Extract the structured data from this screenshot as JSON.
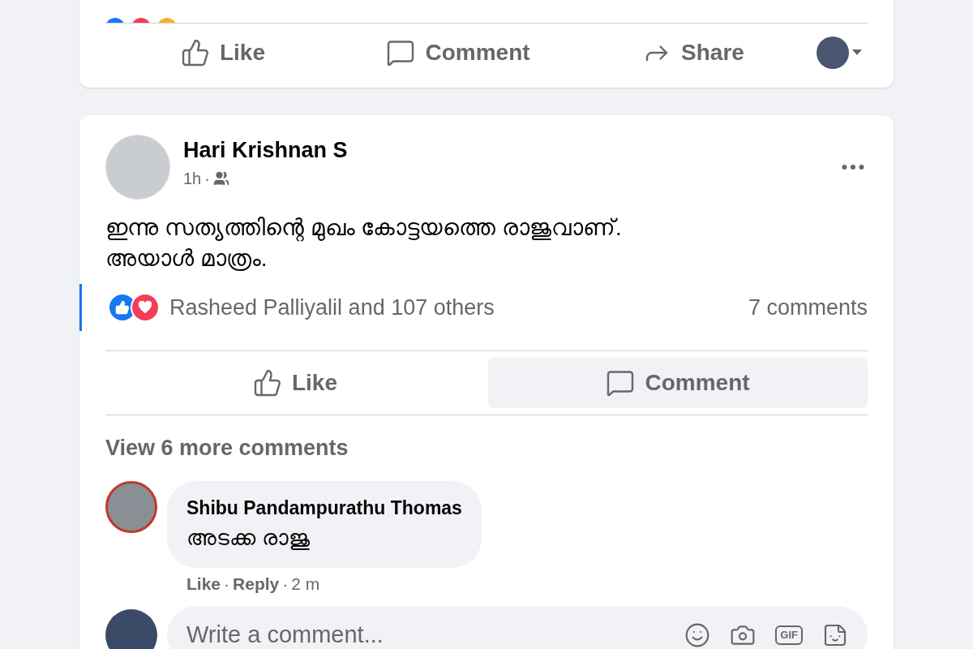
{
  "previous_post": {
    "actions": [
      {
        "kind": "like",
        "label": "Like"
      },
      {
        "kind": "comment",
        "label": "Comment"
      },
      {
        "kind": "share",
        "label": "Share"
      }
    ]
  },
  "post": {
    "author": "Hari Krishnan S",
    "time": "1h",
    "separator": "·",
    "text_lines": [
      "ഇന്നു സത്യത്തിന്റെ മുഖം കോട്ടയത്തെ രാജുവാണ്.",
      "അയാൾ മാത്രം."
    ],
    "reactions_summary": "Rasheed Palliyalil and 107 others",
    "comment_count": "7 comments",
    "actions": [
      {
        "kind": "like",
        "label": "Like",
        "highlighted": false
      },
      {
        "kind": "comment",
        "label": "Comment",
        "highlighted": true
      }
    ],
    "view_more": "View 6 more comments",
    "comments": [
      {
        "author": "Shibu Pandampurathu Thomas",
        "text": "അടക്ക രാജു",
        "actions": [
          "Like",
          "Reply"
        ],
        "separator": "·",
        "time": "2 m"
      }
    ],
    "composer": {
      "placeholder": "Write a comment...",
      "gif_label": "GIF"
    }
  }
}
